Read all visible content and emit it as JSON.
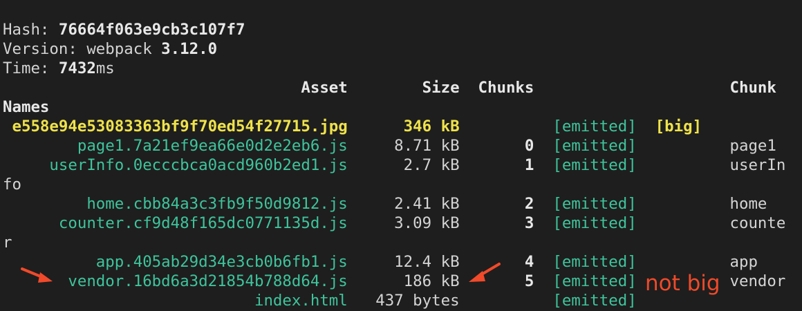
{
  "header": {
    "hash_label": "Hash: ",
    "hash_value": "76664f063e9cb3c107f7",
    "version_label": "Version: webpack ",
    "version_value": "3.12.0",
    "time_label": "Time: ",
    "time_value": "7432",
    "time_unit": "ms"
  },
  "table": {
    "columns": {
      "asset": "Asset",
      "size": "Size",
      "chunks": "Chunks",
      "chunk_names_1": "Chunk",
      "chunk_names_2": "Names"
    },
    "rows": [
      {
        "asset": "e558e94e53083363bf9f70ed54f27715.jpg",
        "size": "346 kB",
        "chunk": "",
        "status": "[emitted]",
        "flag": "[big]",
        "name": "",
        "name_wrap": ""
      },
      {
        "asset": "page1.7a21ef9ea66e0d2e2eb6.js",
        "size": "8.71 kB",
        "chunk": "0",
        "status": "[emitted]",
        "flag": "",
        "name": "page1",
        "name_wrap": ""
      },
      {
        "asset": "userInfo.0ecccbca0acd960b2ed1.js",
        "size": "2.7 kB",
        "chunk": "1",
        "status": "[emitted]",
        "flag": "",
        "name": "userIn",
        "name_wrap": "fo"
      },
      {
        "asset": "home.cbb84a3c3fb9f50d9812.js",
        "size": "2.41 kB",
        "chunk": "2",
        "status": "[emitted]",
        "flag": "",
        "name": "home",
        "name_wrap": ""
      },
      {
        "asset": "counter.cf9d48f165dc0771135d.js",
        "size": "3.09 kB",
        "chunk": "3",
        "status": "[emitted]",
        "flag": "",
        "name": "counte",
        "name_wrap": "r"
      },
      {
        "asset": "app.405ab29d34e3cb0b6fb1.js",
        "size": "12.4 kB",
        "chunk": "4",
        "status": "[emitted]",
        "flag": "",
        "name": "app",
        "name_wrap": ""
      },
      {
        "asset": "vendor.16bd6a3d21854b788d64.js",
        "size": "186 kB",
        "chunk": "5",
        "status": "[emitted]",
        "flag": "",
        "name": "vendor",
        "name_wrap": ""
      },
      {
        "asset": "index.html",
        "size": "437 bytes",
        "chunk": "",
        "status": "[emitted]",
        "flag": "",
        "name": "",
        "name_wrap": ""
      }
    ]
  },
  "annotations": {
    "not_big_label": "not big",
    "arrow_icon": "red-arrow-icon"
  },
  "colors": {
    "background": "#1e1e1e",
    "text": "#d4d4d4",
    "emitted_green": "#3ec49b",
    "big_yellow": "#efe24a",
    "annotation_red": "#f04a2a"
  }
}
